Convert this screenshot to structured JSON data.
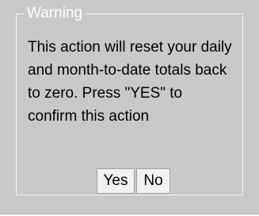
{
  "dialog": {
    "legend": "Warning",
    "message": "This action will reset your daily and month-to-date totals back to zero. Press \"YES\" to confirm this action",
    "yes_label": "Yes",
    "no_label": "No"
  }
}
